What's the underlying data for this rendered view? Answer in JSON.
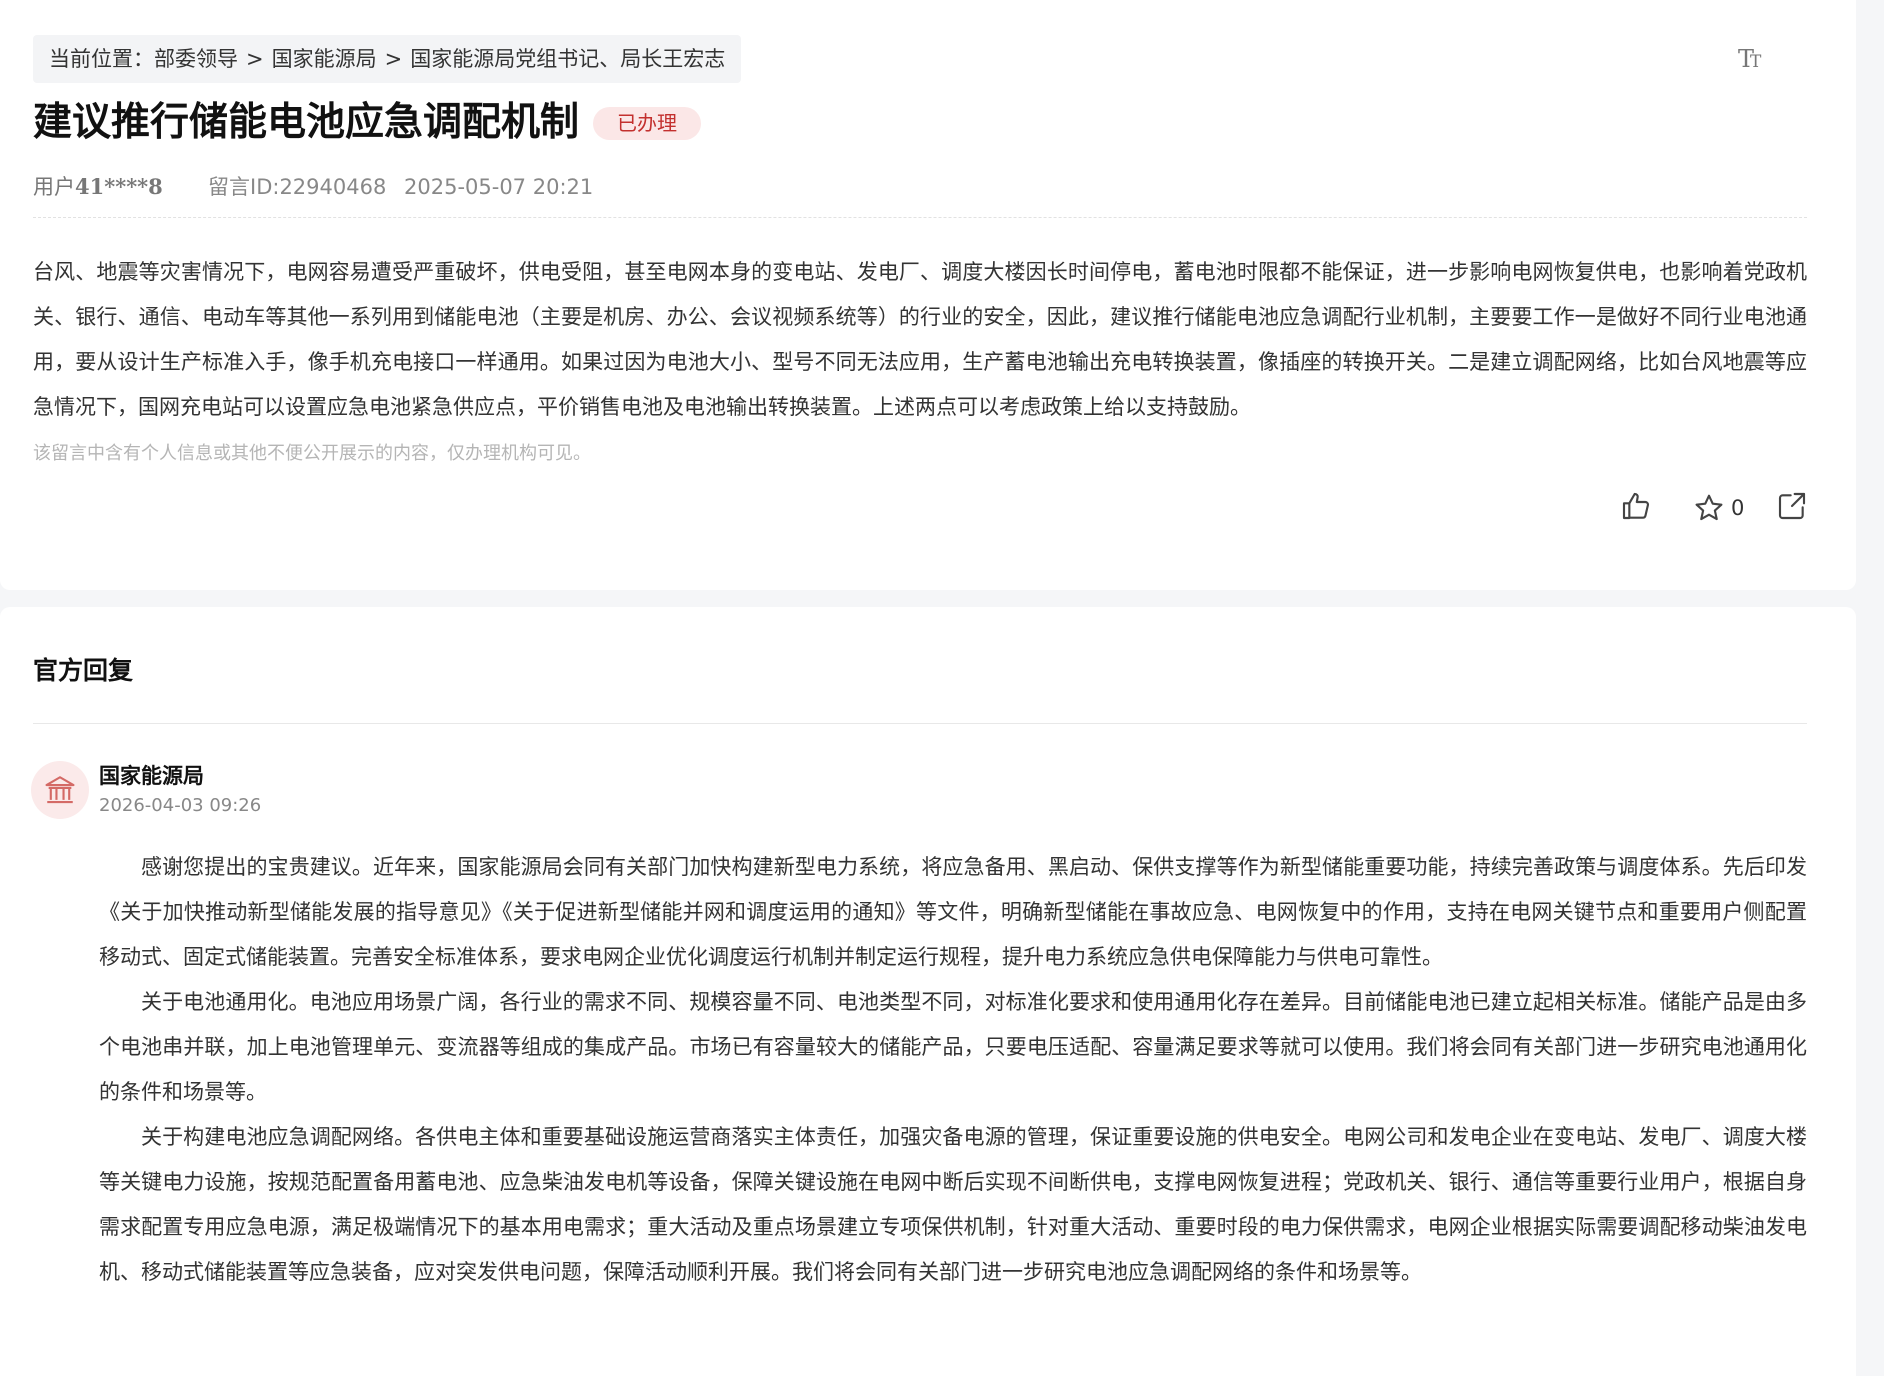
{
  "breadcrumb": {
    "prefix": "当前位置：",
    "items": [
      "部委领导",
      "国家能源局",
      "国家能源局党组书记、局长王宏志"
    ],
    "separator": ">"
  },
  "font_toggle": {
    "label": "TT",
    "icon": "font-size-icon"
  },
  "message": {
    "title": "建议推行储能电池应急调配机制",
    "status_badge": "已办理",
    "user_label": "用户",
    "user_id": "41****8",
    "msg_id": "留言ID:22940468",
    "datetime": "2025-05-07 20:21",
    "content": "台风、地震等灾害情况下，电网容易遭受严重破坏，供电受阻，甚至电网本身的变电站、发电厂、调度大楼因长时间停电，蓄电池时限都不能保证，进一步影响电网恢复供电，也影响着党政机关、银行、通信、电动车等其他一系列用到储能电池（主要是机房、办公、会议视频系统等）的行业的安全，因此，建议推行储能电池应急调配行业机制，主要要工作一是做好不同行业电池通用，要从设计生产标准入手，像手机充电接口一样通用。如果过因为电池大小、型号不同无法应用，生产蓄电池输出充电转换装置，像插座的转换开关。二是建立调配网络，比如台风地震等应急情况下，国网充电站可以设置应急电池紧急供应点，平价销售电池及电池输出转换装置。上述两点可以考虑政策上给以支持鼓励。",
    "privacy_hint": "该留言中含有个人信息或其他不便公开展示的内容，仅办理机构可见。"
  },
  "actions": {
    "like_icon": "thumbs-up-icon",
    "favorite_icon": "star-icon",
    "favorite_count": "0",
    "share_icon": "share-icon"
  },
  "reply": {
    "section_title": "官方回复",
    "org_icon": "government-building-icon",
    "org_name": "国家能源局",
    "datetime": "2026-04-03 09:26",
    "paragraphs": [
      "感谢您提出的宝贵建议。近年来，国家能源局会同有关部门加快构建新型电力系统，将应急备用、黑启动、保供支撑等作为新型储能重要功能，持续完善政策与调度体系。先后印发《关于加快推动新型储能发展的指导意见》《关于促进新型储能并网和调度运用的通知》等文件，明确新型储能在事故应急、电网恢复中的作用，支持在电网关键节点和重要用户侧配置移动式、固定式储能装置。完善安全标准体系，要求电网企业优化调度运行机制并制定运行规程，提升电力系统应急供电保障能力与供电可靠性。",
      "关于电池通用化。电池应用场景广阔，各行业的需求不同、规模容量不同、电池类型不同，对标准化要求和使用通用化存在差异。目前储能电池已建立起相关标准。储能产品是由多个电池串并联，加上电池管理单元、变流器等组成的集成产品。市场已有容量较大的储能产品，只要电压适配、容量满足要求等就可以使用。我们将会同有关部门进一步研究电池通用化的条件和场景等。",
      "关于构建电池应急调配网络。各供电主体和重要基础设施运营商落实主体责任，加强灾备电源的管理，保证重要设施的供电安全。电网公司和发电企业在变电站、发电厂、调度大楼等关键电力设施，按规范配置备用蓄电池、应急柴油发电机等设备，保障关键设施在电网中断后实现不间断供电，支撑电网恢复进程；党政机关、银行、通信等重要行业用户，根据自身需求配置专用应急电源，满足极端情况下的基本用电需求；重大活动及重点场景建立专项保供机制，针对重大活动、重要时段的电力保供需求，电网企业根据实际需要调配移动柴油发电机、移动式储能装置等应急装备，应对突发供电问题，保障活动顺利开展。我们将会同有关部门进一步研究电池应急调配网络的条件和场景等。"
    ]
  }
}
